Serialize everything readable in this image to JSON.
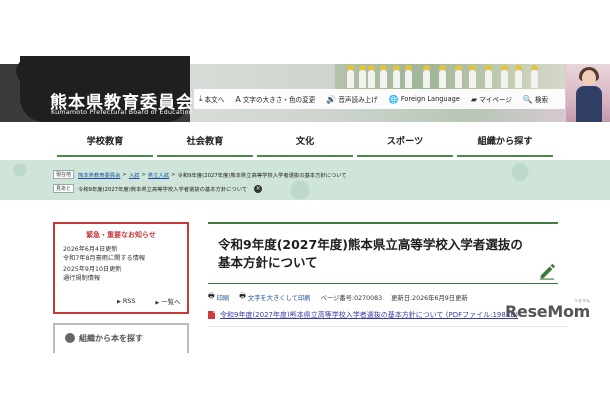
{
  "header": {
    "org_title": "熊本県教育委員会",
    "org_subtitle": "Kumamoto Prefectural Board of Education",
    "utility": [
      {
        "icon": "download-icon",
        "glyph": "⤓",
        "label": "本文へ"
      },
      {
        "icon": "text-size-icon",
        "glyph": "A",
        "label": "文字の大きさ・色の変更"
      },
      {
        "icon": "speaker-icon",
        "glyph": "🔊",
        "label": "音声読み上げ"
      },
      {
        "icon": "globe-icon",
        "glyph": "🌐",
        "label": "Foreign Language"
      },
      {
        "icon": "folder-icon",
        "glyph": "▰",
        "label": "マイページ"
      },
      {
        "icon": "search-icon",
        "glyph": "🔍",
        "label": "検索"
      }
    ]
  },
  "nav": {
    "items": [
      "学校教育",
      "社会教育",
      "文化",
      "スポーツ",
      "組織から探す"
    ]
  },
  "breadcrumb": {
    "tag_current": "現在地",
    "links": [
      "熊本県教育委員会",
      "入試",
      "県立入試"
    ],
    "current": "令和9年度(2027年度)熊本県立高等学校入学者選抜の基本方針について",
    "tag_history": "見あと",
    "history_item": "令和9年度(2027年度)熊本県立高等学校入学者選抜の基本方針について",
    "close_glyph": "×"
  },
  "sidebar": {
    "heading": "緊急・重要なお知らせ",
    "news": [
      {
        "date": "2026年6月4日更新",
        "title": "令和7年8月豪雨に関する情報"
      },
      {
        "date": "2025年9月10日更新",
        "title": "通行規制情報"
      }
    ],
    "rss_label": "RSS",
    "list_label": "一覧へ",
    "box2_title": "組織から本を探す"
  },
  "main": {
    "title": "令和9年度(2027年度)熊本県立高等学校入学者選抜の基本方針について",
    "print_label": "印刷",
    "enlarge_label": "文字を大きくして印刷",
    "page_id": "ページ番号:0270083",
    "updated": "更新日:2026年6月9日更新",
    "pdf_link": "令和9年度(2027年度)熊本県立高等学校入学者選抜の基本方針について (PDFファイル:198KB)"
  },
  "watermark": {
    "text": "ReseMom",
    "kana": "リセマム"
  },
  "colors": {
    "accent_green": "#3f7a3f",
    "alert_red": "#c73a3a",
    "link_blue": "#1a4fa8",
    "crumb_band": "#cfe5d9"
  }
}
